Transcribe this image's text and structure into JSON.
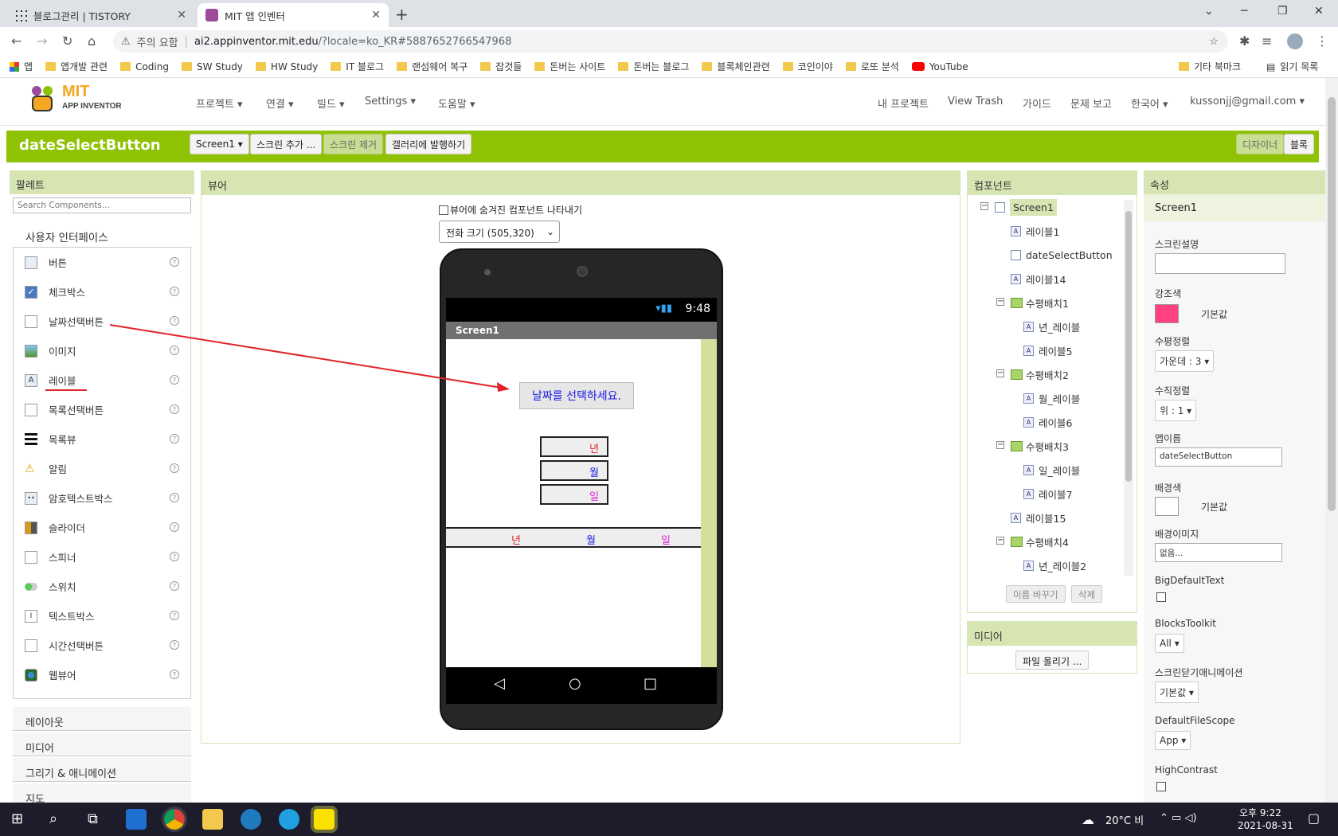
{
  "browser": {
    "tabs": [
      {
        "label": "블로그관리 | TISTORY"
      },
      {
        "label": "MIT 앱 인벤터"
      }
    ],
    "url_warning": "주의 요함",
    "url_host": "ai2.appinventor.mit.edu",
    "url_path": "/?locale=ko_KR#5887652766547968",
    "bookmarks": [
      "앱",
      "앱개발 관련",
      "Coding",
      "SW Study",
      "HW Study",
      "IT 블로그",
      "랜섬웨어 복구",
      "잡것들",
      "돈버는 사이트",
      "돈버는 블로그",
      "블록체인관련",
      "코인이야",
      "로또 분석",
      "YouTube"
    ],
    "bookmarks_right": [
      "기타 북마크",
      "읽기 목록"
    ]
  },
  "app": {
    "logo_top": "MIT",
    "logo_bottom": "APP INVENTOR",
    "menu": [
      "프로젝트 ▾",
      "연결 ▾",
      "빌드 ▾",
      "Settings ▾",
      "도움말 ▾"
    ],
    "menu_right": [
      "내 프로젝트",
      "View Trash",
      "가이드",
      "문제 보고",
      "한국어 ▾",
      "kussonjj@gmail.com ▾"
    ],
    "project_name": "dateSelectButton",
    "toolbar": {
      "screen": "Screen1 ▾",
      "add_screen": "스크린 추가 ...",
      "remove_screen": "스크린 제거",
      "publish": "갤러리에 발행하기",
      "designer": "디자이너",
      "blocks": "블록"
    }
  },
  "palette": {
    "title": "팔레트",
    "search_placeholder": "Search Components...",
    "category_ui": "사용자 인터페이스",
    "items": [
      "버튼",
      "체크박스",
      "날짜선택버튼",
      "이미지",
      "레이블",
      "목록선택버튼",
      "목록뷰",
      "알림",
      "암호텍스트박스",
      "슬라이더",
      "스피너",
      "스위치",
      "텍스트박스",
      "시간선택버튼",
      "웹뷰어"
    ],
    "categories_collapsed": [
      "레이아웃",
      "미디어",
      "그리기 & 애니메이션",
      "지도"
    ]
  },
  "viewer": {
    "title": "뷰어",
    "show_hidden": "뷰어에 숨겨진 컴포넌트 나타내기",
    "size_select": "전화 크기 (505,320)",
    "time": "9:48",
    "screen_title": "Screen1",
    "date_button": "날짜를 선택하세요.",
    "label_year": "년",
    "label_month": "월",
    "label_day": "일",
    "row_year": "년",
    "row_month": "월",
    "row_day": "일"
  },
  "components": {
    "title": "컴포넌트",
    "tree": [
      {
        "label": "Screen1",
        "level": 0,
        "type": "screen",
        "toggle": "⊟"
      },
      {
        "label": "레이블1",
        "level": 1,
        "type": "label"
      },
      {
        "label": "dateSelectButton",
        "level": 1,
        "type": "date"
      },
      {
        "label": "레이블14",
        "level": 1,
        "type": "label"
      },
      {
        "label": "수평배치1",
        "level": 1,
        "type": "hbox",
        "toggle": "⊟"
      },
      {
        "label": "년_레이블",
        "level": 2,
        "type": "label"
      },
      {
        "label": "레이블5",
        "level": 2,
        "type": "label"
      },
      {
        "label": "수평배치2",
        "level": 1,
        "type": "hbox",
        "toggle": "⊟"
      },
      {
        "label": "월_레이블",
        "level": 2,
        "type": "label"
      },
      {
        "label": "레이블6",
        "level": 2,
        "type": "label"
      },
      {
        "label": "수평배치3",
        "level": 1,
        "type": "hbox",
        "toggle": "⊟"
      },
      {
        "label": "일_레이블",
        "level": 2,
        "type": "label"
      },
      {
        "label": "레이블7",
        "level": 2,
        "type": "label"
      },
      {
        "label": "레이블15",
        "level": 1,
        "type": "label"
      },
      {
        "label": "수평배치4",
        "level": 1,
        "type": "hbox",
        "toggle": "⊟"
      },
      {
        "label": "년_레이블2",
        "level": 2,
        "type": "label"
      }
    ],
    "rename": "이름 바꾸기",
    "delete": "삭제"
  },
  "media": {
    "title": "미디어",
    "upload": "파일 올리기 ..."
  },
  "properties": {
    "title": "속성",
    "component": "Screen1",
    "screen_desc": "스크린설명",
    "accent_label": "강조색",
    "accent_value": "기본값",
    "accent_color": "#ff4081",
    "halign_label": "수평정렬",
    "halign_value": "가운데 : 3 ▾",
    "valign_label": "수직정렬",
    "valign_value": "위 : 1 ▾",
    "appname_label": "앱이름",
    "appname_value": "dateSelectButton",
    "bg_label": "배경색",
    "bg_value": "기본값",
    "bgimg_label": "배경이미지",
    "bgimg_value": "없음...",
    "bigtext_label": "BigDefaultText",
    "toolkit_label": "BlocksToolkit",
    "toolkit_value": "All ▾",
    "closeanim_label": "스크린닫기애니메이션",
    "closeanim_value": "기본값 ▾",
    "filescope_label": "DefaultFileScope",
    "filescope_value": "App ▾",
    "contrast_label": "HighContrast"
  },
  "taskbar": {
    "weather": "20°C 비",
    "time": "오후 9:22",
    "date": "2021-08-31"
  },
  "colors": {
    "green": "#8fc202",
    "panel": "#d7e5b3"
  }
}
